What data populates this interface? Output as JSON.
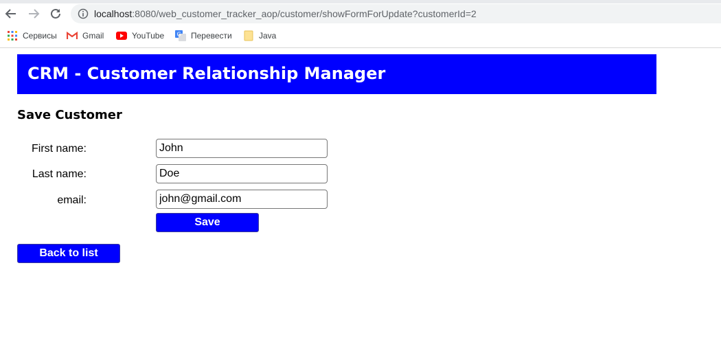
{
  "browser": {
    "url_host": "localhost",
    "url_rest": ":8080/web_customer_tracker_aop/customer/showFormForUpdate?customerId=2",
    "bookmarks": [
      {
        "label": "Сервисы",
        "icon": "apps-grid-icon"
      },
      {
        "label": "Gmail",
        "icon": "gmail-icon"
      },
      {
        "label": "YouTube",
        "icon": "youtube-icon"
      },
      {
        "label": "Перевести",
        "icon": "translate-icon"
      },
      {
        "label": "Java",
        "icon": "folder-icon"
      }
    ]
  },
  "page": {
    "header_title": "CRM - Customer Relationship Manager",
    "form_title": "Save Customer",
    "fields": {
      "first_name": {
        "label": "First name:",
        "value": "John"
      },
      "last_name": {
        "label": "Last name:",
        "value": "Doe"
      },
      "email": {
        "label": "email:",
        "value": "john@gmail.com"
      }
    },
    "save_label": "Save",
    "back_label": "Back to list"
  },
  "colors": {
    "accent": "#0000ff",
    "header_text": "#ffffff"
  }
}
